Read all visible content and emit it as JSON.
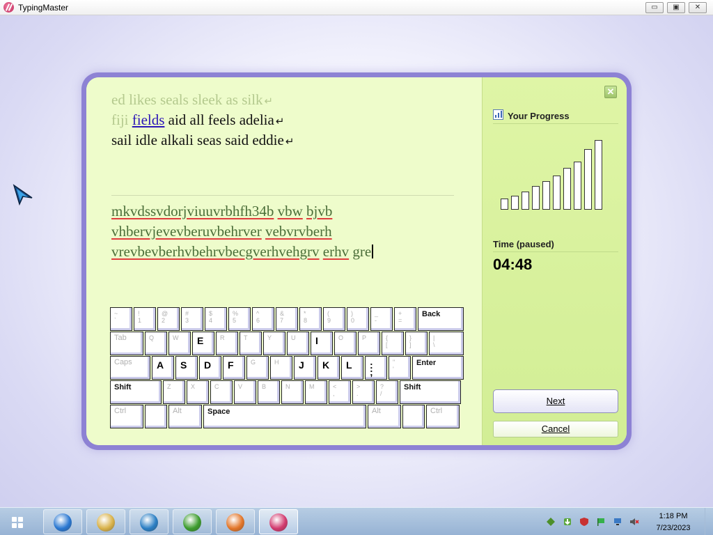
{
  "window": {
    "title": "TypingMaster",
    "controls": {
      "minimize": "▭",
      "maximize": "▣",
      "close": "✕"
    }
  },
  "lesson": {
    "line1": {
      "done": "ed likes seals sleek as silk",
      "return": "↵"
    },
    "line2": {
      "done": "fiji",
      "current": "fields",
      "rest": "aid all feels adelia",
      "return": "↵"
    },
    "line3": {
      "rest": "sail idle alkali seas said eddie",
      "return": "↵"
    }
  },
  "typed": {
    "line1": [
      "mkvdssvdorjviuuvrbhfh34b",
      "vbw",
      "bjvb"
    ],
    "line2": [
      "vhbervjevevberuvbehrver",
      "vebvrvberh"
    ],
    "line3": [
      "vrevbevberhvbehrvbecgverhvehgrv",
      "erhv",
      "gre"
    ]
  },
  "keyboard": {
    "rows": [
      [
        {
          "label": "~\n`"
        },
        {
          "label": "!\n1"
        },
        {
          "label": "@\n2"
        },
        {
          "label": "#\n3"
        },
        {
          "label": "$\n4"
        },
        {
          "label": "%\n5"
        },
        {
          "label": "^\n6"
        },
        {
          "label": "&\n7"
        },
        {
          "label": "*\n8"
        },
        {
          "label": "(\n9"
        },
        {
          "label": ")\n0"
        },
        {
          "label": "_\n-"
        },
        {
          "label": "+\n="
        },
        {
          "label": "Back",
          "type": "mod"
        }
      ],
      [
        {
          "label": "Tab",
          "type": "wide"
        },
        {
          "label": "Q"
        },
        {
          "label": "W"
        },
        {
          "label": "E",
          "active": true
        },
        {
          "label": "R"
        },
        {
          "label": "T"
        },
        {
          "label": "Y"
        },
        {
          "label": "U"
        },
        {
          "label": "I",
          "active": true
        },
        {
          "label": "O"
        },
        {
          "label": "P"
        },
        {
          "label": "{\n["
        },
        {
          "label": "}\n]"
        },
        {
          "label": "|\n\\"
        }
      ],
      [
        {
          "label": "Caps",
          "type": "wide"
        },
        {
          "label": "A",
          "active": true
        },
        {
          "label": "S",
          "active": true
        },
        {
          "label": "D",
          "active": true
        },
        {
          "label": "F",
          "active": true
        },
        {
          "label": "G"
        },
        {
          "label": "H"
        },
        {
          "label": "J",
          "active": true
        },
        {
          "label": "K",
          "active": true
        },
        {
          "label": "L",
          "active": true
        },
        {
          "label": ":\n;",
          "active": true
        },
        {
          "label": "\"\n'"
        },
        {
          "label": "Enter",
          "type": "mod"
        }
      ],
      [
        {
          "label": "Shift",
          "type": "mod"
        },
        {
          "label": "Z"
        },
        {
          "label": "X"
        },
        {
          "label": "C"
        },
        {
          "label": "V"
        },
        {
          "label": "B"
        },
        {
          "label": "N"
        },
        {
          "label": "M"
        },
        {
          "label": "<\n,"
        },
        {
          "label": ">\n."
        },
        {
          "label": "?\n/"
        },
        {
          "label": "Shift",
          "type": "mod"
        }
      ],
      [
        {
          "label": "Ctrl",
          "type": "wide"
        },
        {
          "label": ""
        },
        {
          "label": "Alt",
          "type": "wide"
        },
        {
          "label": "Space",
          "type": "mod"
        },
        {
          "label": "Alt",
          "type": "wide"
        },
        {
          "label": ""
        },
        {
          "label": "Ctrl",
          "type": "wide"
        }
      ]
    ]
  },
  "side": {
    "close": "✕",
    "progress_title": "Your Progress",
    "progress_levels": [
      0.16,
      0.2,
      0.26,
      0.34,
      0.41,
      0.49,
      0.6,
      0.69,
      0.87,
      1.0
    ],
    "time_label": "Time (paused)",
    "time_value": "04:48",
    "next": "Next",
    "cancel": "Cancel"
  },
  "taskbar": {
    "apps": [
      {
        "name": "internet-explorer-icon",
        "color": "#2a78d2"
      },
      {
        "name": "file-explorer-icon",
        "color": "#d9b24a"
      },
      {
        "name": "media-player-icon",
        "color": "#2b7fc4"
      },
      {
        "name": "download-manager-icon",
        "color": "#3d9c2e"
      },
      {
        "name": "firefox-icon",
        "color": "#e3762a"
      },
      {
        "name": "typingmaster-icon",
        "color": "#d23a6e"
      }
    ],
    "clock_time": "1:18 PM",
    "clock_date": "7/23/2023"
  }
}
